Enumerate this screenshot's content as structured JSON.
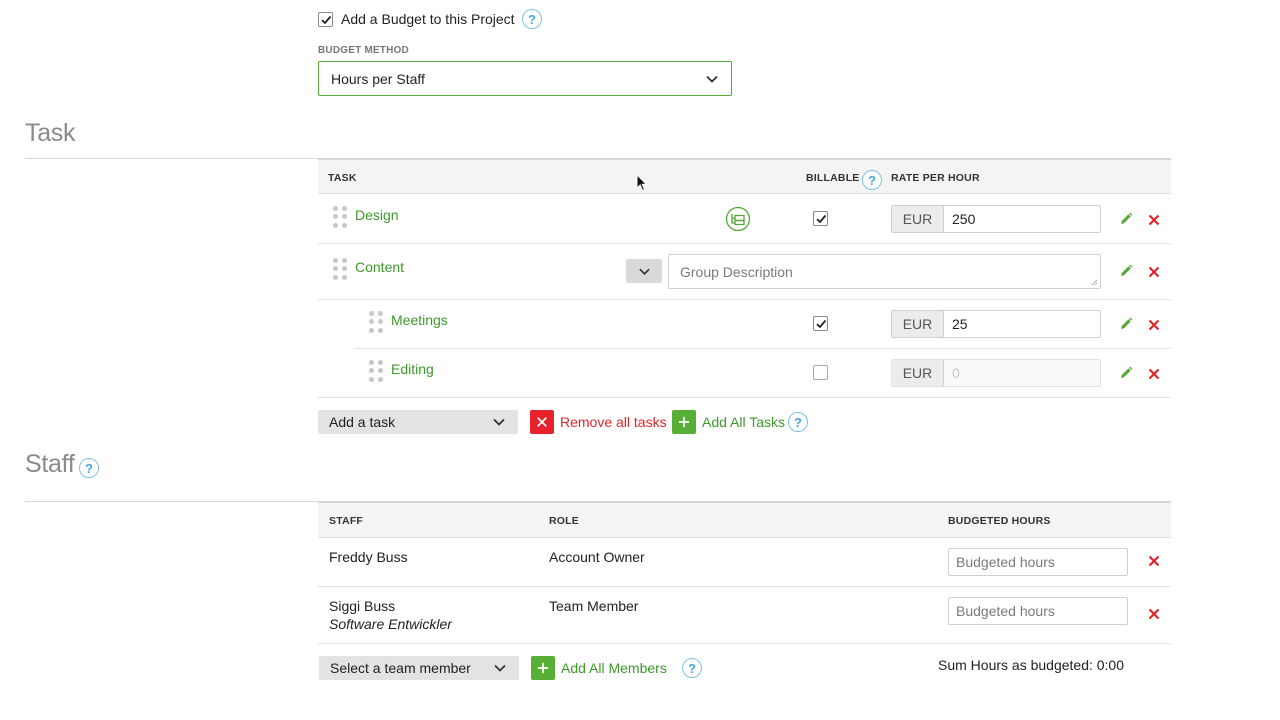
{
  "budget": {
    "add_budget_label": "Add a Budget to this Project",
    "add_budget_checked": true,
    "method_label": "BUDGET METHOD",
    "method_value": "Hours per Staff"
  },
  "task_section": {
    "title": "Task",
    "headers": {
      "task": "TASK",
      "billable": "BILLABLE",
      "rate": "RATE PER HOUR"
    },
    "rows": [
      {
        "name": "Design",
        "billable": true,
        "currency": "EUR",
        "rate": "250"
      },
      {
        "name": "Content",
        "group_description_placeholder": "Group Description"
      },
      {
        "name": "Meetings",
        "billable": true,
        "currency": "EUR",
        "rate": "25"
      },
      {
        "name": "Editing",
        "billable": false,
        "currency": "EUR",
        "rate": "0"
      }
    ],
    "add_task_label": "Add a task",
    "remove_all_label": "Remove all tasks",
    "add_all_label": "Add All Tasks"
  },
  "staff_section": {
    "title": "Staff",
    "headers": {
      "staff": "STAFF",
      "role": "ROLE",
      "hours": "BUDGETED HOURS"
    },
    "rows": [
      {
        "name": "Freddy Buss",
        "title": "",
        "role": "Account Owner",
        "hours_placeholder": "Budgeted hours"
      },
      {
        "name": "Siggi Buss",
        "title": "Software Entwickler",
        "role": "Team Member",
        "hours_placeholder": "Budgeted hours"
      }
    ],
    "select_member_label": "Select a team member",
    "add_all_members_label": "Add All Members",
    "sum_hours_label": "Sum Hours as budgeted: 0:00"
  },
  "icons": {
    "help": "?",
    "accent_green": "#3d9a2a",
    "accent_red": "#e0262b",
    "help_blue": "#4aa6dc"
  }
}
